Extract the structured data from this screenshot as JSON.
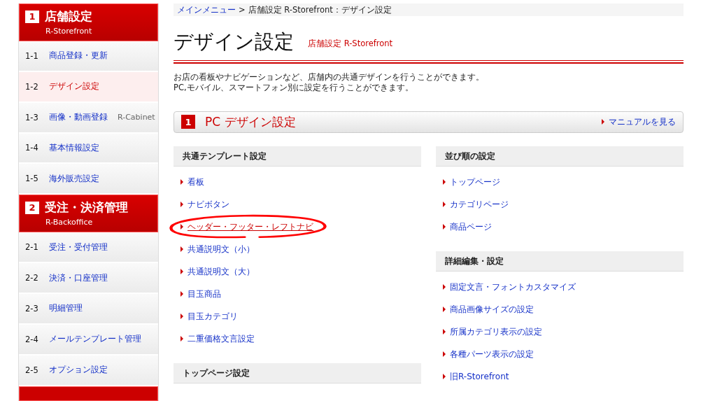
{
  "sidebar": {
    "groups": [
      {
        "number": "1",
        "title": "店舗設定",
        "subtitle": "R-Storefront",
        "items": [
          {
            "code": "1-1",
            "label": "商品登録・更新",
            "selected": false
          },
          {
            "code": "1-2",
            "label": "デザイン設定",
            "selected": true
          },
          {
            "code": "1-3",
            "label": "画像・動画登録",
            "note": "R-Cabinet",
            "selected": false
          },
          {
            "code": "1-4",
            "label": "基本情報設定",
            "selected": false
          },
          {
            "code": "1-5",
            "label": "海外販売設定",
            "selected": false
          }
        ]
      },
      {
        "number": "2",
        "title": "受注・決済管理",
        "subtitle": "R-Backoffice",
        "items": [
          {
            "code": "2-1",
            "label": "受注・受付管理",
            "selected": false
          },
          {
            "code": "2-2",
            "label": "決済・口座管理",
            "selected": false
          },
          {
            "code": "2-3",
            "label": "明細管理",
            "selected": false
          },
          {
            "code": "2-4",
            "label": "メールテンプレート管理",
            "selected": false
          },
          {
            "code": "2-5",
            "label": "オプション設定",
            "selected": false
          }
        ]
      }
    ]
  },
  "breadcrumb": {
    "link": "メインメニュー",
    "separator": ">",
    "current": "店舗設定  R-Storefront：デザイン設定"
  },
  "page": {
    "title": "デザイン設定",
    "subtitle": "店舗設定 R-Storefront",
    "description": [
      "お店の看板やナビゲーションなど、店舗内の共通デザインを行うことができます。",
      "PC,モバイル、スマートフォン別に設定を行うことができます。"
    ]
  },
  "section": {
    "number": "1",
    "title": "PC デザイン設定",
    "manual_link": "マニュアルを見る"
  },
  "columns": [
    [
      {
        "heading": "共通テンプレート設定",
        "links": [
          {
            "label": "看板",
            "highlighted": false
          },
          {
            "label": "ナビボタン",
            "highlighted": false
          },
          {
            "label": "ヘッダー・フッター・レフトナビ",
            "highlighted": true
          },
          {
            "label": "共通説明文（小）",
            "highlighted": false
          },
          {
            "label": "共通説明文（大）",
            "highlighted": false
          },
          {
            "label": "目玉商品",
            "highlighted": false
          },
          {
            "label": "目玉カテゴリ",
            "highlighted": false
          },
          {
            "label": "二重価格文言設定",
            "highlighted": false
          }
        ]
      },
      {
        "heading": "トップページ設定"
      }
    ],
    [
      {
        "heading": "並び順の設定",
        "links": [
          {
            "label": "トップページ",
            "highlighted": false
          },
          {
            "label": "カテゴリページ",
            "highlighted": false
          },
          {
            "label": "商品ページ",
            "highlighted": false
          }
        ]
      },
      {
        "heading": "詳細編集・設定",
        "links": [
          {
            "label": "固定文言・フォントカスタマイズ",
            "highlighted": false
          },
          {
            "label": "商品画像サイズの設定",
            "highlighted": false
          },
          {
            "label": "所属カテゴリ表示の設定",
            "highlighted": false
          },
          {
            "label": "各種パーツ表示の設定",
            "highlighted": false
          },
          {
            "label": "旧R-Storefront",
            "highlighted": false
          }
        ]
      }
    ]
  ]
}
